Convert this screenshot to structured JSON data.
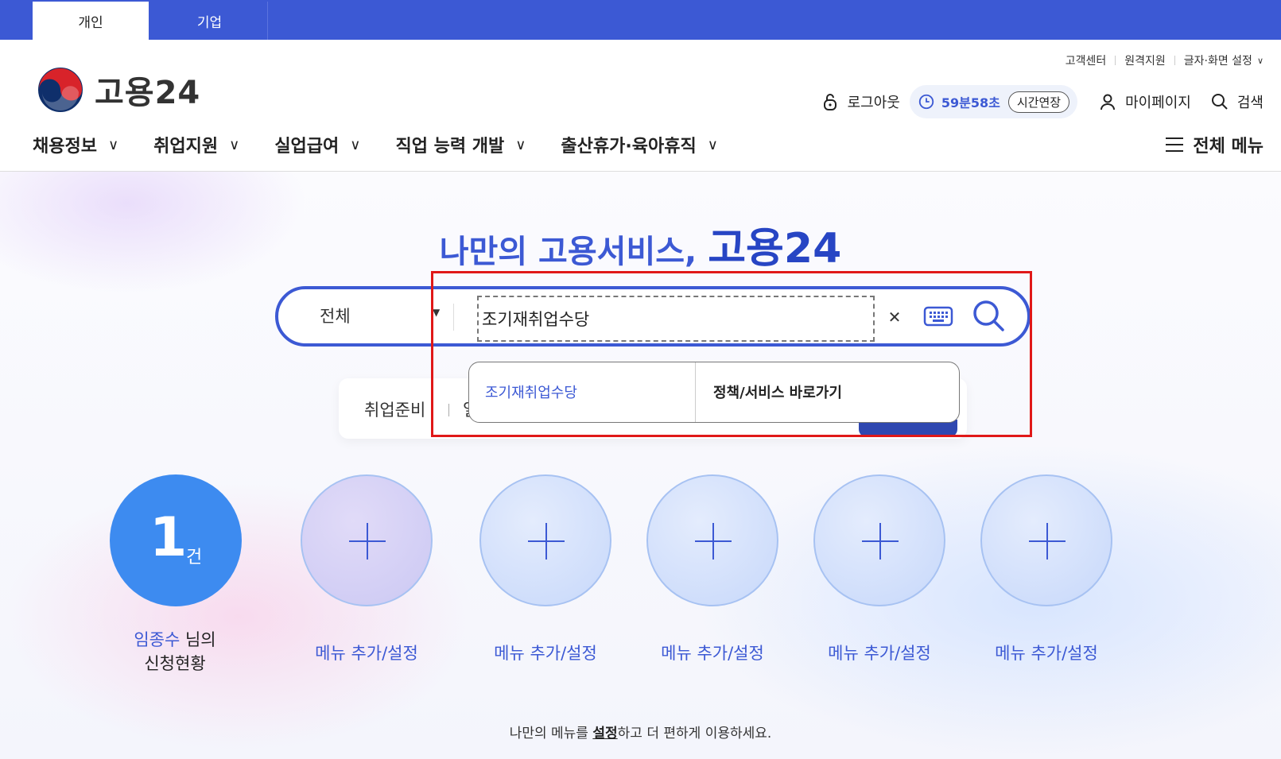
{
  "top_tabs": {
    "personal": "개인",
    "company": "기업"
  },
  "util_links": {
    "customer_center": "고객센터",
    "remote_support": "원격지원",
    "font_settings": "글자·화면 설정"
  },
  "logo": {
    "text": "고용24"
  },
  "account": {
    "logout": "로그아웃",
    "timer": "59분58초",
    "extend": "시간연장",
    "mypage": "마이페이지",
    "search": "검색"
  },
  "gnb": {
    "items": [
      "채용정보",
      "취업지원",
      "실업급여",
      "직업 능력 개발",
      "출산휴가·육아휴직"
    ],
    "all_menu": "전체 메뉴"
  },
  "hero": {
    "title_prefix": "나만의 고용서비스,",
    "title_brand": "고용24"
  },
  "search": {
    "category": "전체",
    "query": "조기재취업수당"
  },
  "quick_tags": {
    "tag1": "취업준비",
    "tag2_partial": "일"
  },
  "autocomplete": {
    "suggestion": "조기재취업수당",
    "shortcut": "정책/서비스 바로가기"
  },
  "status": {
    "count": "1",
    "unit": "건",
    "user_name": "임종수",
    "suffix": " 님의",
    "line2": "신청현황"
  },
  "menu_slots": {
    "label": "메뉴 추가/설정",
    "count_slots": 5
  },
  "footnote": {
    "before": "나만의 메뉴를 ",
    "link": "설정",
    "after": "하고 더 편하게 이용하세요."
  },
  "colors": {
    "brand_blue": "#3c59d4",
    "highlight_red": "#e01818",
    "count_blue": "#3d8bf0"
  }
}
